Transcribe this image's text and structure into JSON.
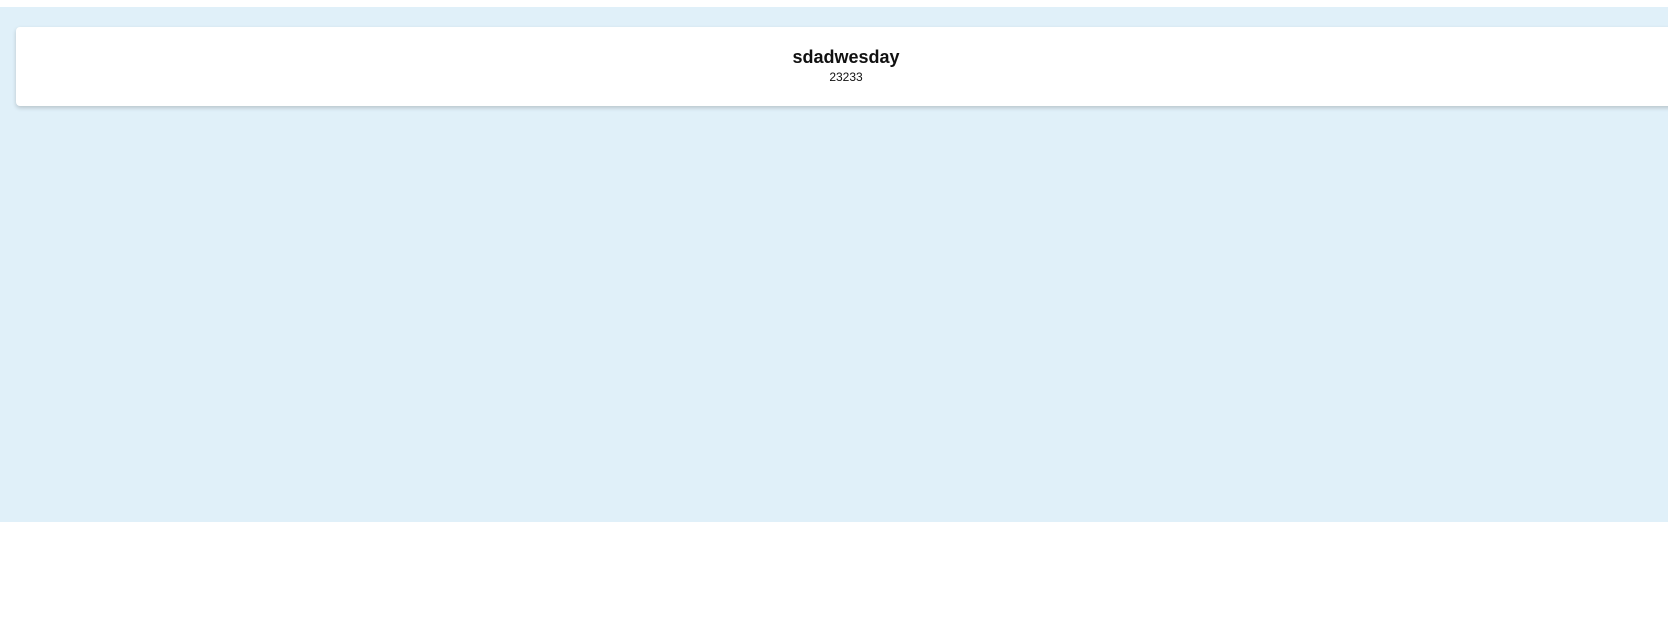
{
  "header": {
    "title": "sdadwesday",
    "subtitle": "23233"
  },
  "colors": {
    "background": "#e0f0f9",
    "card": "#ffffff",
    "text": "#111111"
  }
}
